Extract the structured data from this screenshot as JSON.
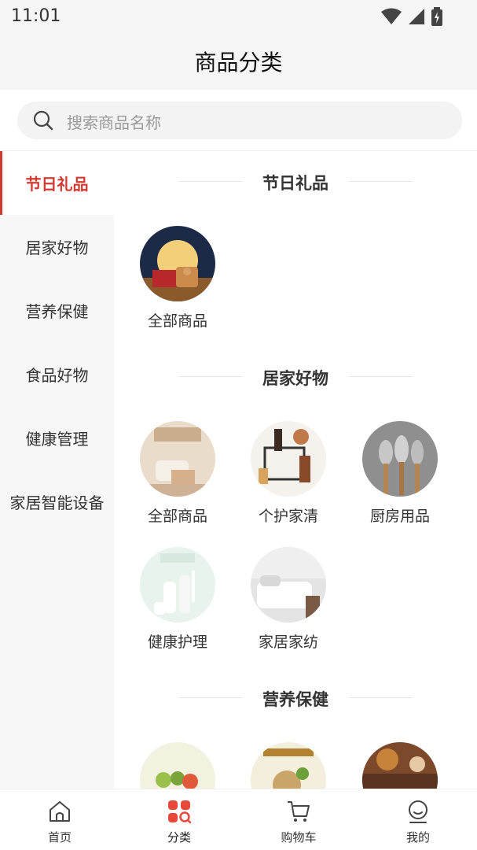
{
  "status": {
    "time": "11:01"
  },
  "header": {
    "title": "商品分类"
  },
  "search": {
    "placeholder": "搜索商品名称"
  },
  "sidebar": {
    "items": [
      {
        "label": "节日礼品",
        "active": true
      },
      {
        "label": "居家好物",
        "active": false
      },
      {
        "label": "营养保健",
        "active": false
      },
      {
        "label": "食品好物",
        "active": false
      },
      {
        "label": "健康管理",
        "active": false
      },
      {
        "label": "家居智能设备",
        "active": false
      }
    ]
  },
  "sections": [
    {
      "title": "节日礼品",
      "items": [
        {
          "label": "全部商品"
        }
      ]
    },
    {
      "title": "居家好物",
      "items": [
        {
          "label": "全部商品"
        },
        {
          "label": "个护家清"
        },
        {
          "label": "厨房用品"
        },
        {
          "label": "健康护理"
        },
        {
          "label": "家居家纺"
        }
      ]
    },
    {
      "title": "营养保健",
      "items": [
        {
          "label": ""
        },
        {
          "label": ""
        },
        {
          "label": ""
        }
      ]
    }
  ],
  "tabbar": {
    "tabs": [
      {
        "label": "首页",
        "icon": "home-icon",
        "active": false
      },
      {
        "label": "分类",
        "icon": "category-icon",
        "active": true
      },
      {
        "label": "购物车",
        "icon": "cart-icon",
        "active": false
      },
      {
        "label": "我的",
        "icon": "profile-icon",
        "active": false
      }
    ]
  },
  "colors": {
    "accent": "#d23a2f",
    "sidebar_bg": "#f7f7f7",
    "header_bg": "#f5f5f5"
  }
}
